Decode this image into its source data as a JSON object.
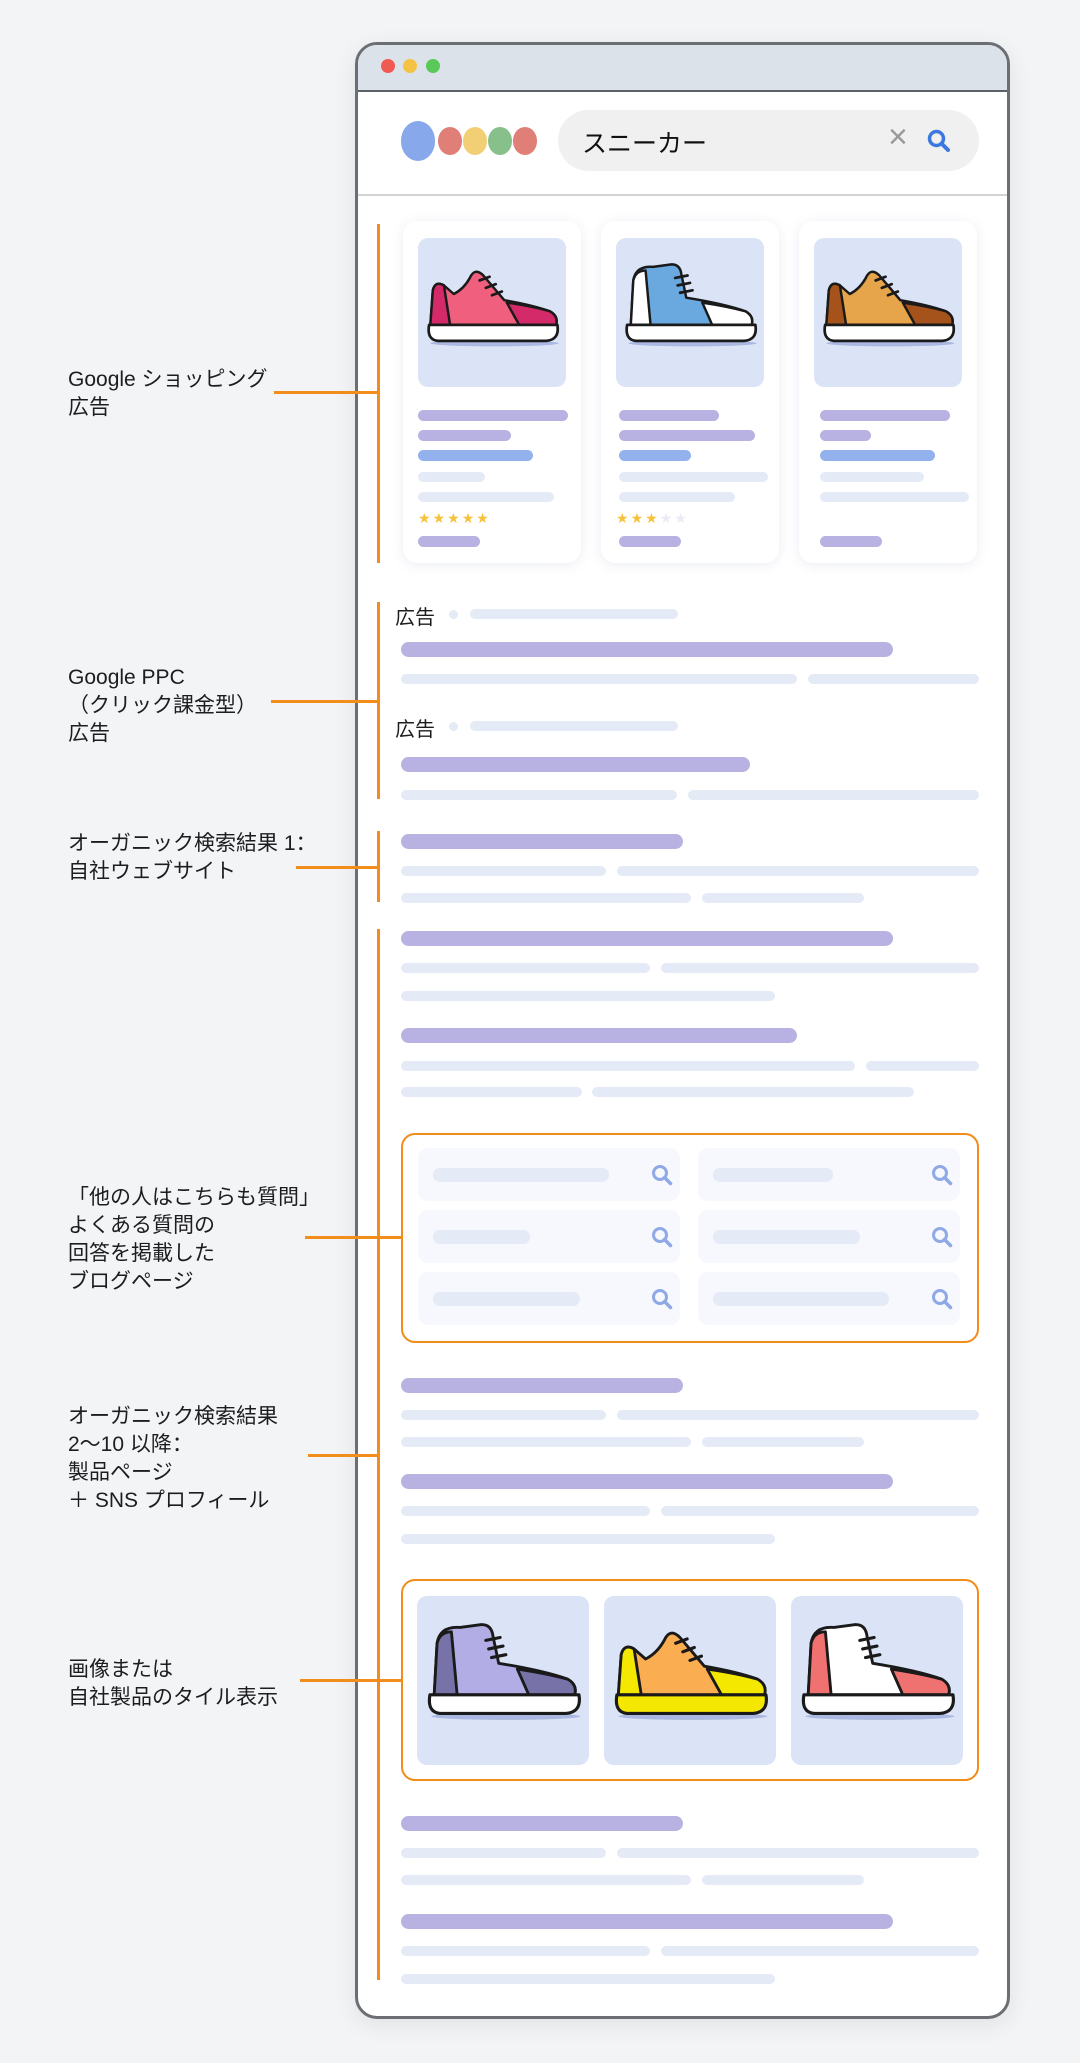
{
  "annotations": [
    {
      "text": "Google ショッピング\n広告"
    },
    {
      "text": "Google PPC\n（クリック課金型）\n広告"
    },
    {
      "text": "オーガニック検索結果 1：\n自社ウェブサイト"
    },
    {
      "text": "「他の人はこちらも質問」\nよくある質問の\n回答を掲載した\nブログページ"
    },
    {
      "text": "オーガニック検索結果\n2〜10 以降：\n製品ページ\n＋ SNS プロフィール"
    },
    {
      "text": "画像または\n自社製品のタイル表示"
    }
  ],
  "browser": {
    "search_query": "スニーカー",
    "clear_icon": "×",
    "search_icon": "search-icon"
  },
  "ads": [
    {
      "label": "広告"
    },
    {
      "label": "広告"
    }
  ],
  "shopping": [
    {
      "rating": 5,
      "max": 5,
      "colors": {
        "main": "#f0607e",
        "accent": "#d42a6a",
        "sole": "#ffffff"
      },
      "style": "low"
    },
    {
      "rating": 3,
      "max": 5,
      "colors": {
        "main": "#6aa8e0",
        "accent": "#ffffff",
        "sole": "#ffffff"
      },
      "style": "high"
    },
    {
      "rating": null,
      "max": 5,
      "colors": {
        "main": "#e6a54a",
        "accent": "#a5521b",
        "sole": "#ffffff"
      },
      "style": "low"
    }
  ],
  "tiles": [
    {
      "colors": {
        "main": "#b3ade6",
        "accent": "#7772a8",
        "sole": "#ffffff"
      },
      "style": "high"
    },
    {
      "colors": {
        "main": "#fbad52",
        "accent": "#f4e800",
        "sole": "#f4e800"
      },
      "style": "low"
    },
    {
      "colors": {
        "main": "#ffffff",
        "accent": "#f07270",
        "sole": "#ffffff"
      },
      "style": "high"
    }
  ],
  "colors": {
    "accent_orange": "#f28c1a",
    "title_bar": "#b8b2e2",
    "text_bar": "#e5eaf7",
    "price_bar": "#93b1ec",
    "star": "#f7c23a",
    "star_empty": "#e9ebf5",
    "logo": [
      "#88a8ec",
      "#e07f78",
      "#f2cf74",
      "#88c08c",
      "#e07f78"
    ]
  }
}
